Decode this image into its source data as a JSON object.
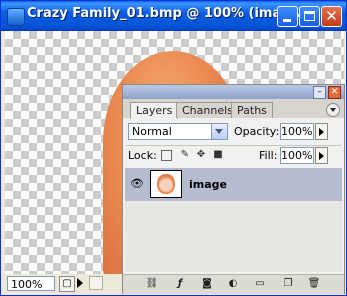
{
  "window": {
    "title": "Crazy Family_01.bmp @ 100% (imag...",
    "app_icon": "photoshop-document-icon",
    "buttons": [
      "minimize",
      "maximize",
      "close"
    ]
  },
  "status_bar": {
    "zoom": "100%",
    "status_button_icon": "page-icon"
  },
  "layers_panel": {
    "tabs": [
      {
        "label": "Layers",
        "active": true
      },
      {
        "label": "Channels",
        "active": false
      },
      {
        "label": "Paths",
        "active": false
      }
    ],
    "blend_mode": "Normal",
    "opacity_label": "Opacity:",
    "opacity_value": "100%",
    "lock_label": "Lock:",
    "fill_label": "Fill:",
    "fill_value": "100%",
    "layers": [
      {
        "name": "image",
        "visible": true,
        "selected": true
      }
    ],
    "bottom_icons": [
      "link-icon",
      "layer-style-icon",
      "mask-icon",
      "adjustment-layer-icon",
      "new-group-icon",
      "new-layer-icon",
      "trash-icon"
    ]
  },
  "colors": {
    "titlebar": "#0a5ce0",
    "selected_layer": "#b6bccf",
    "hair": "#ea8a52"
  }
}
